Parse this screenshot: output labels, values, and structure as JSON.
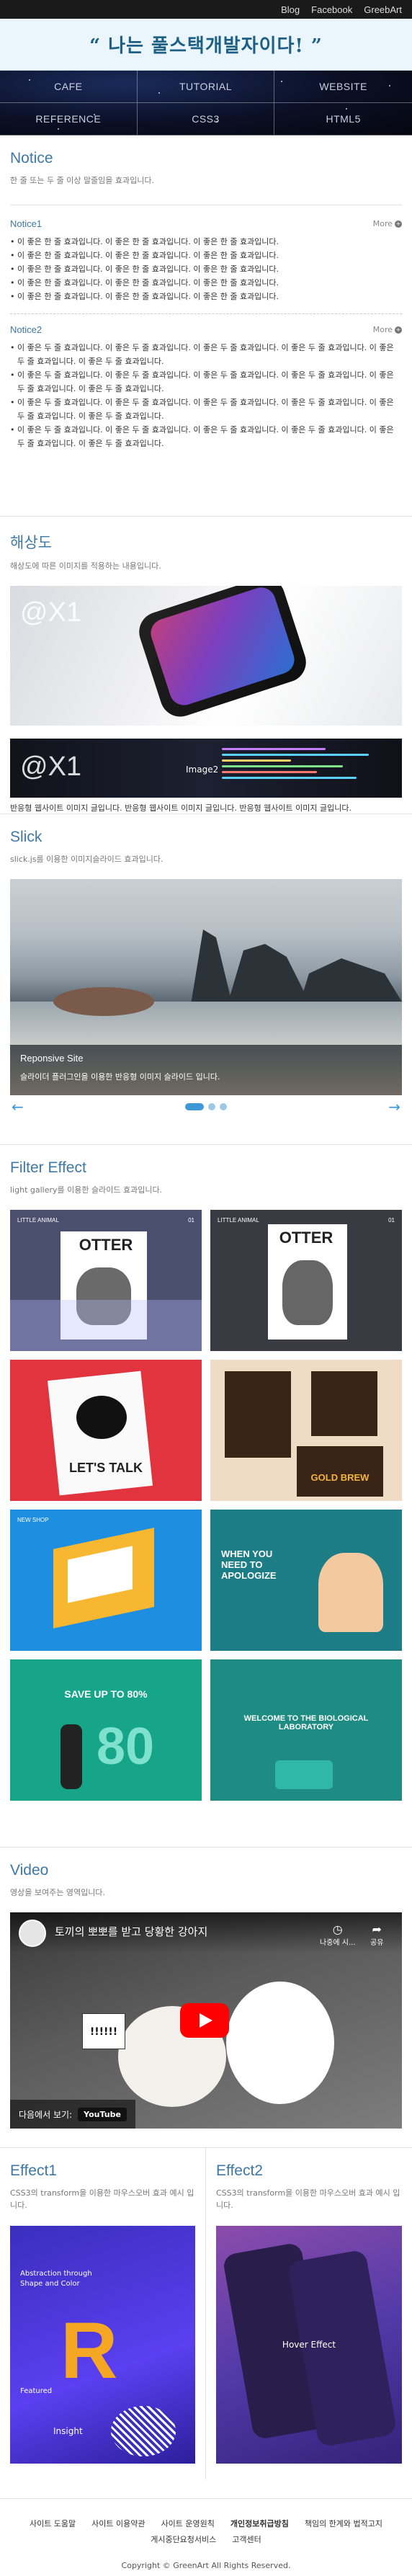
{
  "topbar": {
    "links": [
      "Blog",
      "Facebook",
      "GreebArt"
    ]
  },
  "banner": {
    "slogan": "“ 나는 풀스택개발자이다! ”"
  },
  "nav": {
    "items": [
      "CAFE",
      "TUTORIAL",
      "WEBSITE",
      "REFERENCE",
      "CSS3",
      "HTML5"
    ]
  },
  "notice": {
    "title": "Notice",
    "desc": "한 줄 또는 두 줄 이상 말줄임을 효과입니다.",
    "more_label": "More",
    "block1": {
      "title": "Notice1",
      "items": [
        "이 좋은 한 줄 효과입니다. 이 좋은 한 줄 효과입니다. 이 좋은 한 줄 효과입니다.",
        "이 좋은 한 줄 효과입니다. 이 좋은 한 줄 효과입니다. 이 좋은 한 줄 효과입니다.",
        "이 좋은 한 줄 효과입니다. 이 좋은 한 줄 효과입니다. 이 좋은 한 줄 효과입니다.",
        "이 좋은 한 줄 효과입니다. 이 좋은 한 줄 효과입니다. 이 좋은 한 줄 효과입니다.",
        "이 좋은 한 줄 효과입니다. 이 좋은 한 줄 효과입니다. 이 좋은 한 줄 효과입니다."
      ]
    },
    "block2": {
      "title": "Notice2",
      "items": [
        "이 좋은 두 줄 효과입니다. 이 좋은 두 줄 효과입니다. 이 좋은 두 줄 효과입니다. 이 좋은 두 줄 효과입니다. 이 좋은 두 줄 효과입니다. 이 좋은 두 줄 효과입니다.",
        "이 좋은 두 줄 효과입니다. 이 좋은 두 줄 효과입니다. 이 좋은 두 줄 효과입니다. 이 좋은 두 줄 효과입니다. 이 좋은 두 줄 효과입니다. 이 좋은 두 줄 효과입니다.",
        "이 좋은 두 줄 효과입니다. 이 좋은 두 줄 효과입니다. 이 좋은 두 줄 효과입니다. 이 좋은 두 줄 효과입니다. 이 좋은 두 줄 효과입니다. 이 좋은 두 줄 효과입니다.",
        "이 좋은 두 줄 효과입니다. 이 좋은 두 줄 효과입니다. 이 좋은 두 줄 효과입니다. 이 좋은 두 줄 효과입니다. 이 좋은 두 줄 효과입니다. 이 좋은 두 줄 효과입니다."
      ]
    }
  },
  "resolution": {
    "title": "해상도",
    "desc": "해상도에 따른 이미지를 적용하는 내용입니다.",
    "img1_logo": "@X1",
    "img2_logo": "@X1",
    "img2_label": "Image2",
    "text": "반응형 웹사이트 이미지 글입니다. 반응형 웹사이트 이미지 글입니다. 반응형 웹사이트 이미지 글입니다."
  },
  "slick": {
    "title": "Slick",
    "desc": "slick.js를 이용한 이미지슬라이드 효과입니다.",
    "caption_title": "Reponsive Site",
    "caption_text": "슬라이더 플러그인을 이용한 반응형 이미지 슬라이드 입니다.",
    "prev_icon": "arrow-left",
    "next_icon": "arrow-right",
    "active_dot": 0,
    "dot_count": 3
  },
  "filter": {
    "title": "Filter Effect",
    "desc": "light gallery를 이용한 슬라이드 효과입니다.",
    "tiles": [
      {
        "heading": "OTTER",
        "tag": "LITTLE ANIMAL",
        "num": "01",
        "bg": "#4a4f6e",
        "fg": "#ffffff"
      },
      {
        "heading": "OTTER",
        "tag": "LITTLE ANIMAL",
        "num": "01",
        "bg": "#3a3b42",
        "fg": "#ffffff"
      },
      {
        "heading": "LET'S TALK",
        "tag": "",
        "num": "",
        "bg": "#e2343f",
        "fg": "#222222"
      },
      {
        "heading": "GOLD BREW",
        "tag": "",
        "num": "",
        "bg": "#f0dcc4",
        "fg": "#3a2418"
      },
      {
        "heading": "",
        "tag": "NEW SHOP",
        "num": "",
        "bg": "#1e8fe0",
        "fg": "#ffffff"
      },
      {
        "heading": "WHEN YOU NEED TO APOLOGIZE",
        "tag": "",
        "num": "",
        "bg": "#1d7d86",
        "fg": "#ffffff"
      },
      {
        "heading": "SAVE UP TO 80%",
        "tag": "",
        "num": "",
        "bg": "#17a589",
        "fg": "#ffffff"
      },
      {
        "heading": "WELCOME TO THE BIOLOGICAL LABORATORY",
        "tag": "",
        "num": "",
        "bg": "#1e8c82",
        "fg": "#ffffff"
      }
    ]
  },
  "video": {
    "title": "Video",
    "desc": "영상을 보여주는 영역입니다.",
    "video_title": "토끼의 뽀뽀를 받고 당황한 강아지",
    "later_label": "나중에 시...",
    "share_label": "공유",
    "watch_label": "다음에서 보기:",
    "youtube_label": "YouTube",
    "sign_text": "!!!!!!"
  },
  "effects": [
    {
      "title": "Effect1",
      "desc": "CSS3의 transform을 이용한 마우스오버 효과 예시 입니다.",
      "img_text": "Abstraction through Shape and Color",
      "img_letter": "R",
      "img_sub": "Insight",
      "img_featured": "Featured"
    },
    {
      "title": "Effect2",
      "desc": "CSS3의 transform을 이용한 마우스오버 효과 예시 입니다.",
      "hover_label": "Hover Effect"
    }
  ],
  "footer": {
    "links": [
      "사이트 도움말",
      "사이트 이용약관",
      "사이트 운영원칙",
      "개인정보취급방침",
      "책임의 한계와 법적고지",
      "게시중단요청서비스",
      "고객센터"
    ],
    "copyright": "Copyright © GreenArt All Rights Reserved."
  }
}
